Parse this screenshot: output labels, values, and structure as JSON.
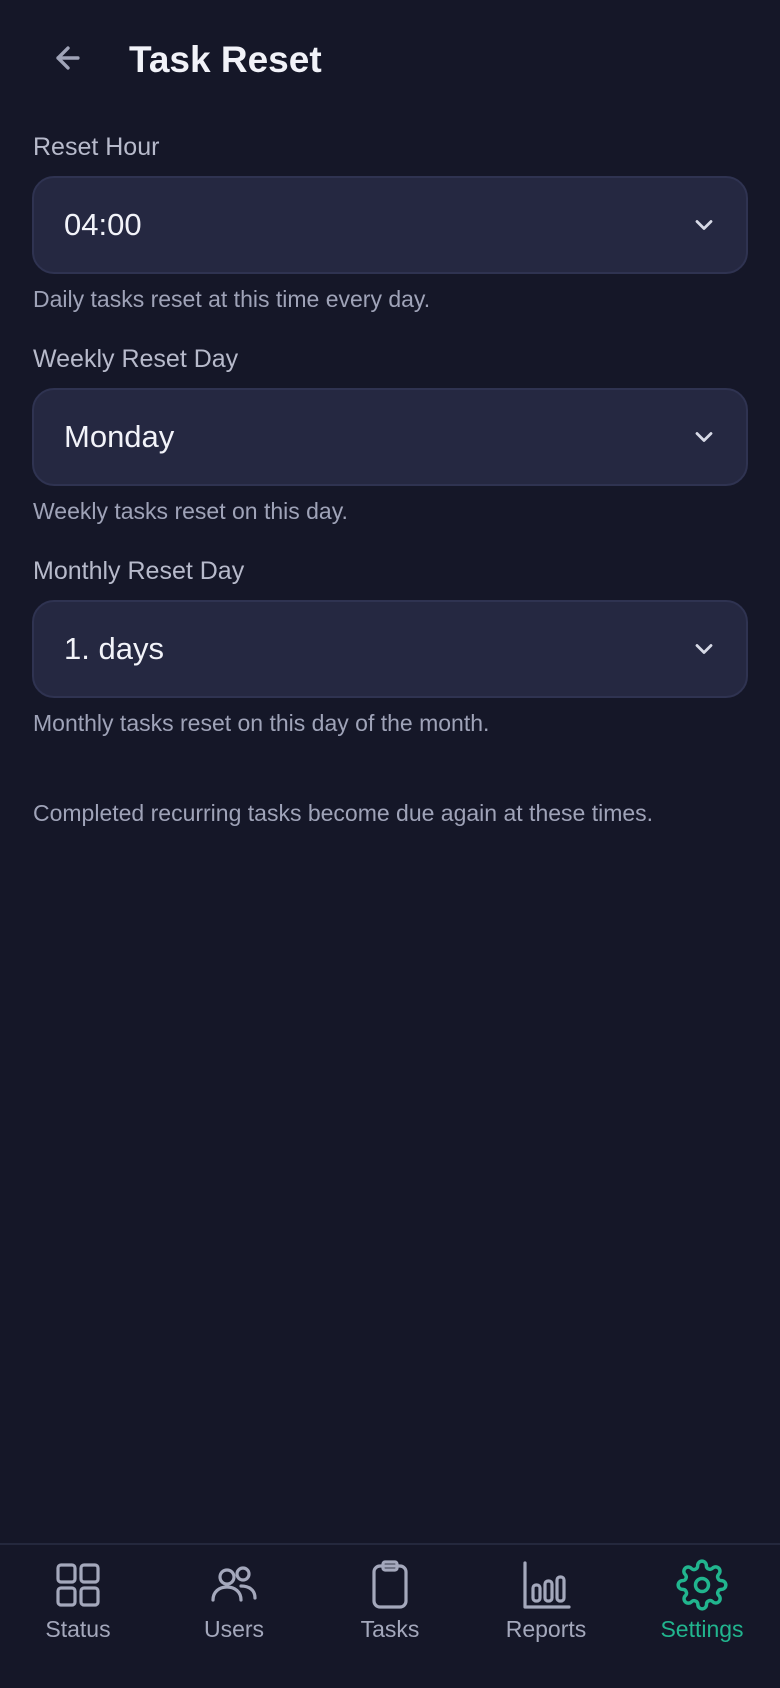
{
  "header": {
    "title": "Task Reset",
    "back_icon": "arrow-left-icon"
  },
  "fields": {
    "reset_hour": {
      "label": "Reset Hour",
      "value": "04:00",
      "help": "Daily tasks reset at this time every day."
    },
    "weekly_reset_day": {
      "label": "Weekly Reset Day",
      "value": "Monday",
      "help": "Weekly tasks reset on this day."
    },
    "monthly_reset_day": {
      "label": "Monthly Reset Day",
      "value": "1. days",
      "help": "Monthly tasks reset on this day of the month."
    }
  },
  "footer_note": "Completed recurring tasks become due again at these times.",
  "nav": {
    "items": [
      {
        "label": "Status",
        "icon": "grid-icon"
      },
      {
        "label": "Users",
        "icon": "users-icon"
      },
      {
        "label": "Tasks",
        "icon": "clipboard-icon"
      },
      {
        "label": "Reports",
        "icon": "bar-chart-icon"
      },
      {
        "label": "Settings",
        "icon": "gear-icon"
      }
    ],
    "active_index": 4
  },
  "colors": {
    "background": "#151728",
    "field_background": "#252841",
    "accent": "#21b58e",
    "muted_text": "#9fa3b8"
  }
}
